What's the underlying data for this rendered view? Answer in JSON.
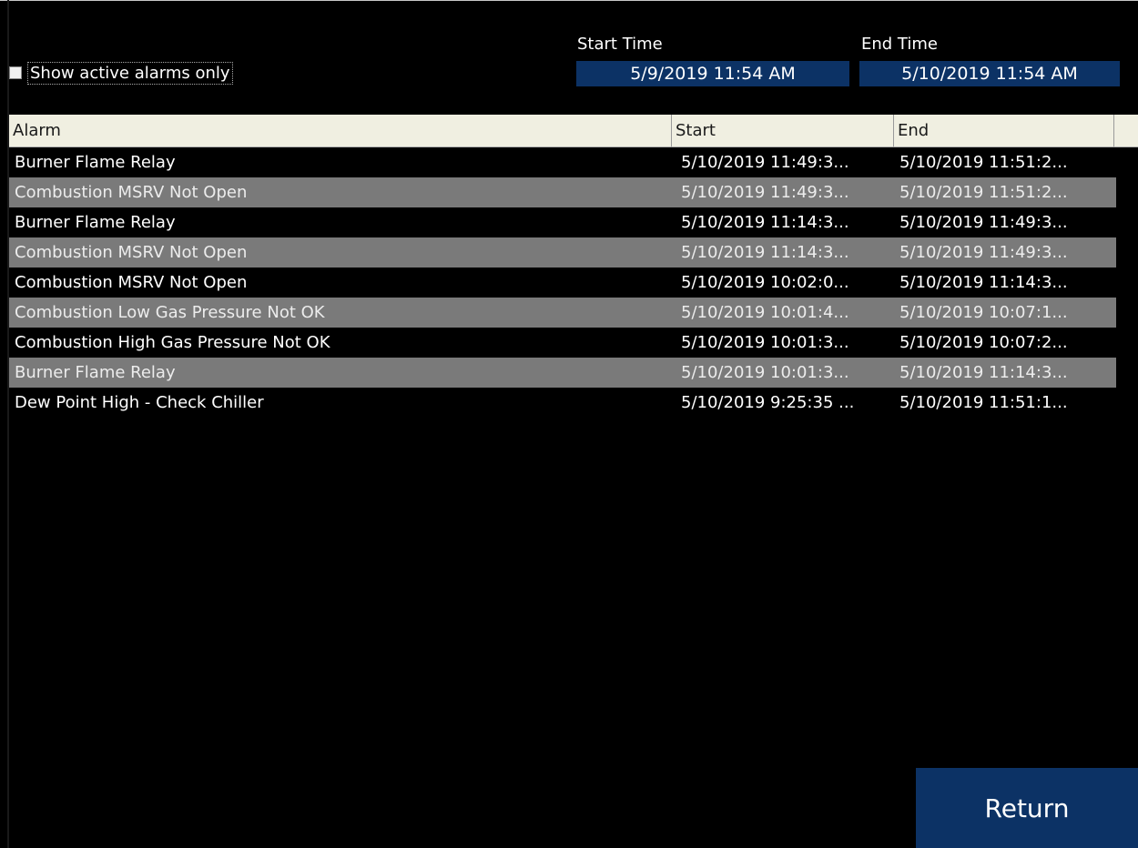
{
  "filters": {
    "active_only_label": "Show active alarms only",
    "active_only_checked": false,
    "start_time_label": "Start Time",
    "start_time_value": "5/9/2019 11:54 AM",
    "end_time_label": "End Time",
    "end_time_value": "5/10/2019 11:54 AM"
  },
  "table": {
    "columns": [
      "Alarm",
      "Start",
      "End"
    ],
    "rows": [
      {
        "alarm": "Burner Flame Relay",
        "start": "5/10/2019 11:49:3...",
        "end": "5/10/2019 11:51:2..."
      },
      {
        "alarm": "Combustion MSRV Not Open",
        "start": "5/10/2019 11:49:3...",
        "end": "5/10/2019 11:51:2..."
      },
      {
        "alarm": "Burner Flame Relay",
        "start": "5/10/2019 11:14:3...",
        "end": "5/10/2019 11:49:3..."
      },
      {
        "alarm": "Combustion MSRV Not Open",
        "start": "5/10/2019 11:14:3...",
        "end": "5/10/2019 11:49:3..."
      },
      {
        "alarm": "Combustion MSRV Not Open",
        "start": "5/10/2019 10:02:0...",
        "end": "5/10/2019 11:14:3..."
      },
      {
        "alarm": "Combustion Low Gas Pressure Not OK",
        "start": "5/10/2019 10:01:4...",
        "end": "5/10/2019 10:07:1..."
      },
      {
        "alarm": "Combustion High Gas Pressure Not OK",
        "start": "5/10/2019 10:01:3...",
        "end": "5/10/2019 10:07:2..."
      },
      {
        "alarm": "Burner Flame Relay",
        "start": "5/10/2019 10:01:3...",
        "end": "5/10/2019 11:14:3..."
      },
      {
        "alarm": "Dew Point High - Check Chiller",
        "start": "5/10/2019 9:25:35 ...",
        "end": "5/10/2019 11:51:1..."
      }
    ]
  },
  "actions": {
    "return_label": "Return"
  },
  "colors": {
    "background": "#000000",
    "accent_blue": "#0c3265",
    "header_bg": "#f0efe1",
    "alt_row_bg": "#7a7a7a"
  }
}
